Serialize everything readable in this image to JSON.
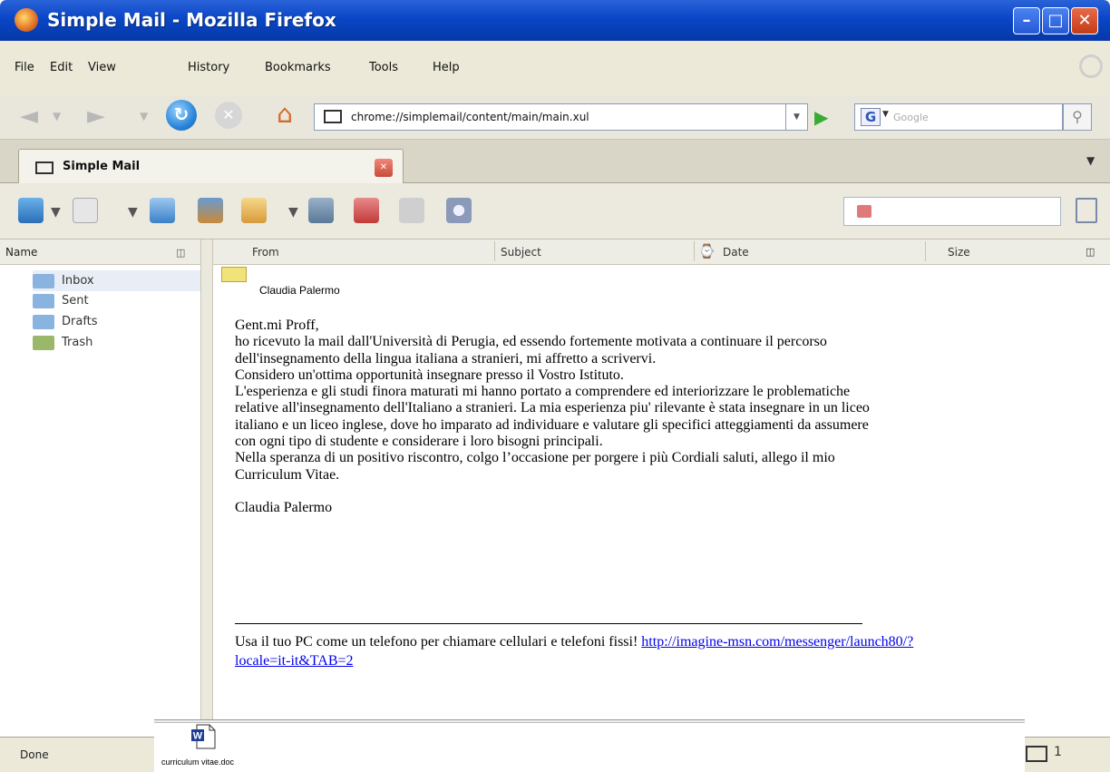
{
  "window": {
    "title": "Simple Mail - Mozilla Firefox"
  },
  "menubar": {
    "items": [
      "File",
      "Edit",
      "View",
      "History",
      "Bookmarks",
      "Tools",
      "Help"
    ]
  },
  "navbar": {
    "url": "chrome://simplemail/content/main/main.xul",
    "search_placeholder": "Google"
  },
  "tab": {
    "label": "Simple Mail"
  },
  "folders": {
    "header": "Name",
    "items": [
      "Inbox",
      "Sent",
      "Drafts",
      "Trash"
    ]
  },
  "message_list": {
    "columns": {
      "from": "From",
      "subject": "Subject",
      "date": "Date",
      "size": "Size"
    }
  },
  "message": {
    "from": "Claudia Palermo",
    "body": "Gent.mi Proff,\nho ricevuto la mail dall'Università di Perugia, ed essendo fortemente motivata a continuare il percorso\ndell'insegnamento della lingua italiana a stranieri, mi affretto a scrivervi.\nConsidero un'ottima opportunità insegnare presso il Vostro Istituto.\nL'esperienza e gli studi finora maturati mi hanno portato a comprendere ed interiorizzare le problematiche\nrelative all'insegnamento dell'Italiano a stranieri. La mia esperienza piu' rilevante è stata insegnare in un liceo\nitaliano e un liceo inglese, dove ho imparato ad individuare e valutare gli specifici atteggiamenti da assumere\ncon ogni tipo di studente e considerare i loro bisogni principali.\nNella speranza di un positivo riscontro, colgo l’occasione per porgere i più Cordiali saluti, allego il mio\nCurriculum Vitae.\n\nClaudia Palermo",
    "footer_text": "Usa il tuo PC come un telefono per chiamare cellulari e telefoni fissi! ",
    "footer_link": "http://imagine-msn.com/messenger/launch80/?locale=it-it&TAB=2",
    "attachment": "curriculum vitae.doc"
  },
  "statusbar": {
    "text": "Done",
    "count": "1"
  }
}
